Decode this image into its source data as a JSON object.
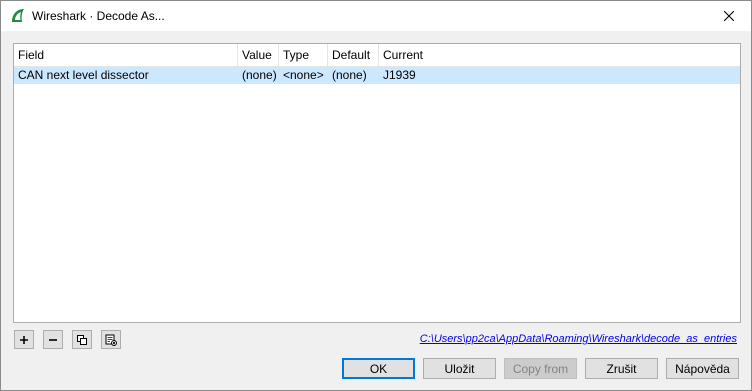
{
  "window": {
    "title": "Wireshark · Decode As...",
    "accent_color": "#1e8c3a"
  },
  "table": {
    "columns": [
      "Field",
      "Value",
      "Type",
      "Default",
      "Current"
    ],
    "rows": [
      {
        "field": "CAN next level dissector",
        "value": "(none)",
        "type": "<none>",
        "default": "(none)",
        "current": "J1939"
      }
    ],
    "selection_color": "#cce8ff"
  },
  "toolbar": {
    "icons": [
      "plus-icon",
      "minus-icon",
      "copy-icon",
      "clear-icon"
    ]
  },
  "path_link": "C:\\Users\\pp2ca\\AppData\\Roaming\\Wireshark\\decode_as_entries",
  "buttons": {
    "ok": "OK",
    "save": "Uložit",
    "copy_from": "Copy from",
    "cancel": "Zrušit",
    "help": "Nápověda"
  }
}
